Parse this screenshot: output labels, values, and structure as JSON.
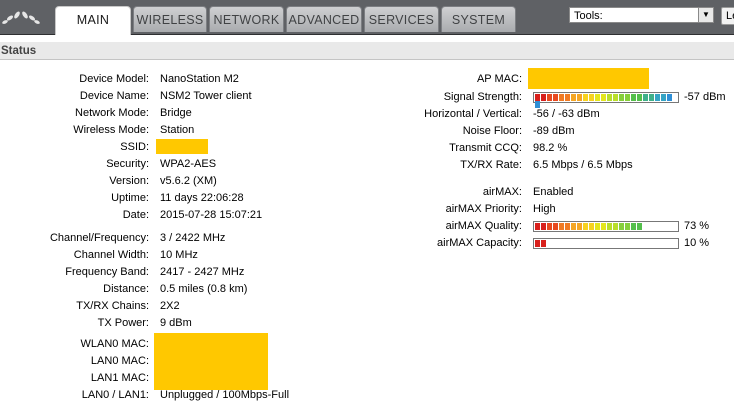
{
  "nav": {
    "tabs": [
      "MAIN",
      "WIRELESS",
      "NETWORK",
      "ADVANCED",
      "SERVICES",
      "SYSTEM"
    ],
    "tools_label": "Tools:",
    "logout_label": "Le"
  },
  "section_title": "Status",
  "left": [
    {
      "label": "Device Model:",
      "value": "NanoStation M2"
    },
    {
      "label": "Device Name:",
      "value": "NSM2 Tower client"
    },
    {
      "label": "Network Mode:",
      "value": "Bridge"
    },
    {
      "label": "Wireless Mode:",
      "value": "Station"
    },
    {
      "label": "SSID:",
      "value": ""
    },
    {
      "label": "Security:",
      "value": "WPA2-AES"
    },
    {
      "label": "Version:",
      "value": "v5.6.2 (XM)"
    },
    {
      "label": "Uptime:",
      "value": "11 days 22:06:28"
    },
    {
      "label": "Date:",
      "value": "2015-07-28 15:07:21"
    },
    {
      "label": "Channel/Frequency:",
      "value": "3 / 2422 MHz"
    },
    {
      "label": "Channel Width:",
      "value": "10 MHz"
    },
    {
      "label": "Frequency Band:",
      "value": "2417 - 2427 MHz"
    },
    {
      "label": "Distance:",
      "value": "0.5 miles (0.8 km)"
    },
    {
      "label": "TX/RX Chains:",
      "value": "2X2"
    },
    {
      "label": "TX Power:",
      "value": "9 dBm"
    },
    {
      "label": "WLAN0 MAC:",
      "value": ""
    },
    {
      "label": "LAN0 MAC:",
      "value": ""
    },
    {
      "label": "LAN1 MAC:",
      "value": ""
    },
    {
      "label": "LAN0 / LAN1:",
      "value": "Unplugged / 100Mbps-Full"
    }
  ],
  "right": [
    {
      "label": "AP MAC:",
      "value": ""
    },
    {
      "label": "Signal Strength:",
      "value": "-57 dBm"
    },
    {
      "label": "Horizontal / Vertical:",
      "value": "-56 / -63 dBm"
    },
    {
      "label": "Noise Floor:",
      "value": "-89 dBm"
    },
    {
      "label": "Transmit CCQ:",
      "value": "98.2 %"
    },
    {
      "label": "TX/RX Rate:",
      "value": "6.5 Mbps / 6.5 Mbps"
    },
    {
      "label": "airMAX:",
      "value": "Enabled"
    },
    {
      "label": "airMAX Priority:",
      "value": "High"
    },
    {
      "label": "airMAX Quality:",
      "value": "73 %"
    },
    {
      "label": "airMAX Capacity:",
      "value": "10 %"
    }
  ],
  "meters": {
    "signal_strength_fraction": 1.0,
    "airmax_quality_fraction": 0.73,
    "airmax_capacity_fraction": 0.1
  },
  "colors": {
    "redaction": "#ffc800",
    "topbar": "#5f6165",
    "meter_gradient": [
      "#d8201c",
      "#e8491f",
      "#f07a24",
      "#f5a623",
      "#f7d21f",
      "#e4e61d",
      "#b9de2a",
      "#86cf3b",
      "#54bf4c",
      "#3fb08a",
      "#35a4c4",
      "#2f8fd6"
    ]
  },
  "icons": {
    "logo": "ubiquiti-logo-icon",
    "dropdown": "chevron-down-icon"
  }
}
